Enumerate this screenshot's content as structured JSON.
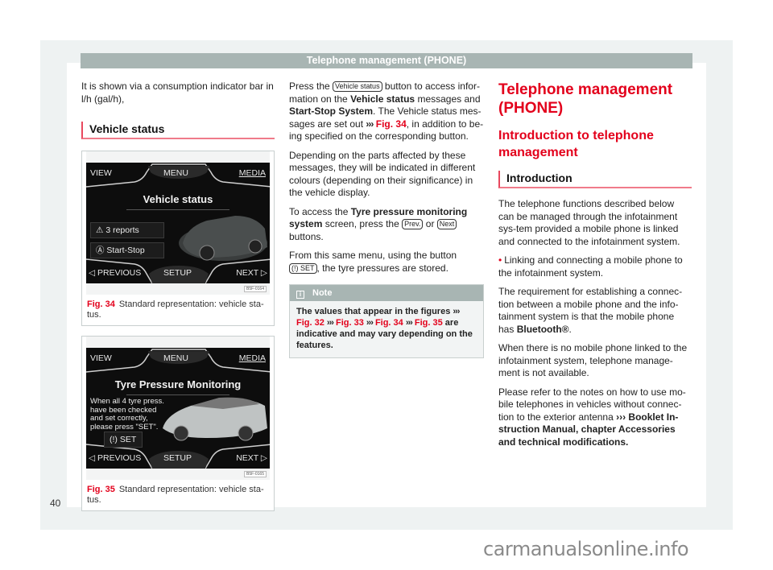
{
  "header": {
    "title": "Telephone management (PHONE)"
  },
  "column1": {
    "intro_text": "It is shown via a consumption indicator bar in l/h (gal/h),",
    "section_heading": "Vehicle status",
    "figures": [
      {
        "screen": {
          "top_left": "VIEW",
          "top_center": "MENU",
          "top_right": "MEDIA",
          "title": "Vehicle status",
          "buttons": [
            {
              "icon": "warning-icon",
              "glyph": "⚠",
              "label": "3 reports"
            },
            {
              "icon": "start-stop-icon",
              "glyph": "Ⓐ",
              "label": "Start-Stop"
            }
          ],
          "bottom_left": "◁ PREVIOUS",
          "bottom_center": "SETUP",
          "bottom_right": "NEXT ▷",
          "code": "B5F-0164"
        },
        "number": "Fig. 34",
        "caption": "Standard representation: vehicle sta-tus."
      },
      {
        "screen": {
          "top_left": "VIEW",
          "top_center": "MENU",
          "top_right": "MEDIA",
          "title": "Tyre Pressure Monitoring",
          "message": "When all 4 tyre press. have been checked and set correctly, please press \"SET\".",
          "buttons": [
            {
              "icon": "tyre-pressure-icon",
              "glyph": "(!)",
              "label": "SET"
            }
          ],
          "bottom_left": "◁ PREVIOUS",
          "bottom_center": "SETUP",
          "bottom_right": "NEXT ▷",
          "code": "B5F-0165"
        },
        "number": "Fig. 35",
        "caption": "Standard representation: vehicle sta-tus."
      }
    ]
  },
  "column2": {
    "p1_a": "Press the ",
    "p1_key": "Vehicle status",
    "p1_b": " button to access infor-mation on the ",
    "p1_bold1": "Vehicle status",
    "p1_c": " messages and ",
    "p1_bold2": "Start-Stop System",
    "p1_d": ". The Vehicle status mes-sages are set out ",
    "p1_ref": "Fig. 34",
    "p1_e": ", in addition to be-ing specified on the corresponding button.",
    "p2": "Depending on the parts affected by these messages, they will be indicated in different colours (depending on their significance) in the vehicle display.",
    "p3_a": "To access the ",
    "p3_bold": "Tyre pressure monitoring system",
    "p3_b": " screen, press the ",
    "p3_key1": "Prev.",
    "p3_c": " or ",
    "p3_key2": "Next",
    "p3_d": " buttons.",
    "p4_a": "From this same menu, using the button ",
    "p4_key": "(!) SET",
    "p4_b": ", the tyre pressures are stored.",
    "note": {
      "title": "Note",
      "body_a": "The values that appear in the figures ",
      "refs": [
        "Fig. 32",
        "Fig. 33",
        "Fig. 34",
        "Fig. 35"
      ],
      "body_b": " are indicative and may vary depending on the features."
    },
    "arrow": "›››"
  },
  "column3": {
    "h1": "Telephone management (PHONE)",
    "h2": "Introduction to telephone management",
    "section_heading": "Introduction",
    "p1": "The telephone functions described below can be managed through the infotainment sys-tem provided a mobile phone is linked and connected to the infotainment system.",
    "bullet": "Linking and connecting a mobile phone to the infotainment system.",
    "p2_a": "The requirement for establishing a connec-tion between a mobile phone and the info-tainment system is that the mobile phone has ",
    "p2_bold": "Bluetooth®",
    "p2_b": ".",
    "p3": "When there is no mobile phone linked to the infotainment system, telephone manage-ment is not available.",
    "p4_a": "Please refer to the notes on how to use mo-bile telephones in vehicles without connec-tion to the exterior antenna ",
    "p4_bold": "››› Booklet In-struction Manual, chapter Accessories and technical modifications."
  },
  "page_number": "40",
  "watermark": "carmanualsonline.info"
}
